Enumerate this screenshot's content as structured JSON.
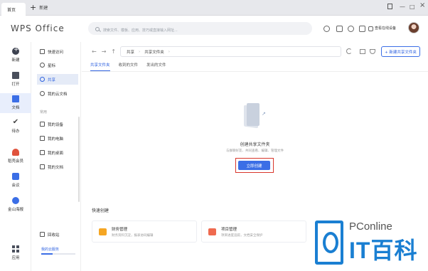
{
  "titlebar": {
    "tabs": [
      "首页",
      "新建"
    ],
    "controls": {
      "restore_icon": "window-restore-icon",
      "minimize": "—",
      "maximize": "□",
      "close": "×"
    }
  },
  "header": {
    "logo": "WPS Office",
    "search_placeholder": "搜索文件、模板、应用、技巧或直接输入网址...",
    "monitor_label": "查看在线设备"
  },
  "leftnav": [
    {
      "label": "新建",
      "icon": "plus-circle-icon"
    },
    {
      "label": "打开",
      "icon": "folder-icon"
    },
    {
      "label": "文档",
      "icon": "document-icon",
      "active": true
    },
    {
      "label": "待办",
      "icon": "checkmark-icon"
    },
    {
      "label": "稻壳会员",
      "icon": "docer-icon"
    },
    {
      "label": "会议",
      "icon": "meeting-icon"
    },
    {
      "label": "金山海报",
      "icon": "poster-icon"
    },
    {
      "label": "应用",
      "icon": "apps-grid-icon"
    }
  ],
  "sidebar": {
    "items": [
      {
        "label": "快速访问",
        "icon": "pin-icon"
      },
      {
        "label": "星标",
        "icon": "star-icon"
      },
      {
        "label": "共享",
        "icon": "share-icon",
        "active": true
      },
      {
        "label": "我的云文档",
        "icon": "cloud-icon"
      }
    ],
    "section_label": "常用",
    "common": [
      {
        "label": "我的设备",
        "icon": "device-icon"
      },
      {
        "label": "我的电脑",
        "icon": "computer-icon"
      },
      {
        "label": "我的桌面",
        "icon": "desktop-icon"
      },
      {
        "label": "我的文档",
        "icon": "docs-folder-icon"
      }
    ],
    "recycle": "回收站",
    "cloud_space": "我的云服务"
  },
  "main": {
    "breadcrumb": [
      "共享",
      "共享文件夹"
    ],
    "new_button": "+ 新建共享文件夹",
    "tabs": [
      "共享文件夹",
      "收到的文件",
      "发出的文件"
    ],
    "empty_title": "创建共享文件夹",
    "empty_subtitle": "与群聊好友、共同查看、编辑、管理文件",
    "create_button": "立即创建",
    "quick_create_title": "快速创建",
    "cards": [
      {
        "title": "财务管理",
        "subtitle": "财务资料沉淀，报表协同编辑",
        "color": "#f5a623"
      },
      {
        "title": "项目管理",
        "subtitle": "项目进度追踪，文档安全保护",
        "color": "#ef6a4f"
      }
    ]
  },
  "watermark": {
    "top": "PConline",
    "bottom": "IT百科"
  }
}
